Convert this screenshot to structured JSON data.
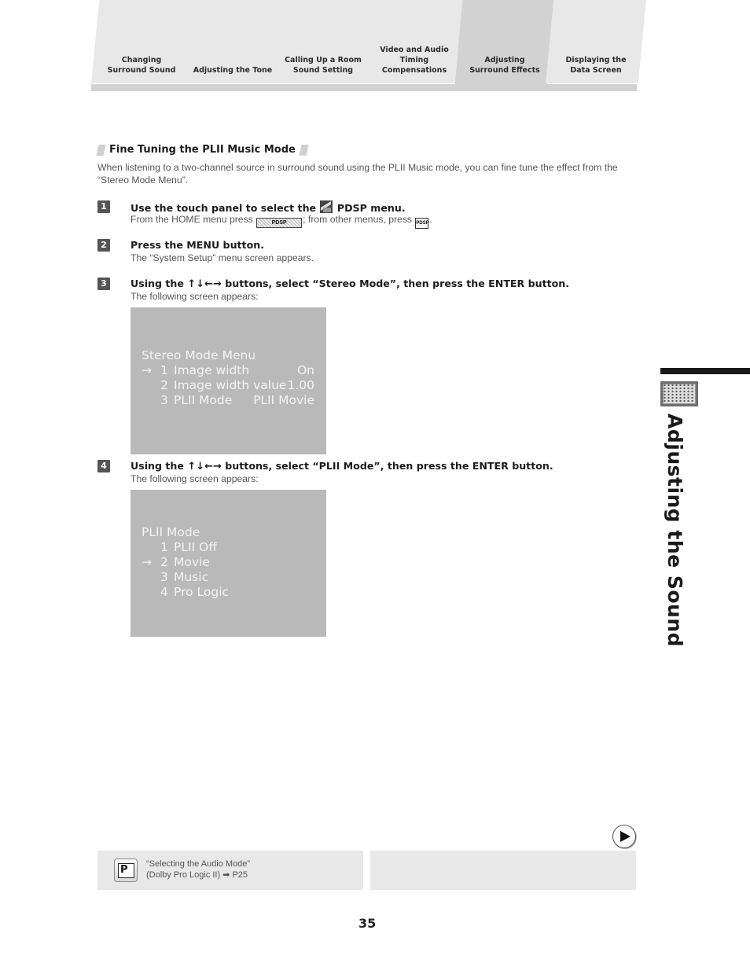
{
  "tabs": [
    {
      "label": "Changing\nSurround Sound",
      "active": false
    },
    {
      "label": "Adjusting the Tone",
      "active": false
    },
    {
      "label": "Calling Up a Room\nSound Setting",
      "active": false
    },
    {
      "label": "Video and Audio\nTiming\nCompensations",
      "active": false
    },
    {
      "label": "Adjusting\nSurround Effects",
      "active": true
    },
    {
      "label": "Displaying the\nData Screen",
      "active": false
    }
  ],
  "section": {
    "title": "Fine Tuning the PLII Music Mode",
    "intro": "When listening to a two-channel source in surround sound using the PLII Music mode, you can fine tune the effect from the “Stereo Mode Menu”."
  },
  "steps": [
    {
      "number": "1",
      "title_before": "Use the touch panel to select the",
      "title_after": "PDSP menu.",
      "icon": "pdsp-menu-icon",
      "sub_before": "From the HOME menu press",
      "key_wide": "PDSP",
      "sub_middle": "; from other menus, press",
      "key_small": "PDSP",
      "sub_after": "."
    },
    {
      "number": "2",
      "title": "Press the MENU button.",
      "sub": "The “System Setup” menu screen appears."
    },
    {
      "number": "3",
      "title_before": "Using the",
      "arrows": "↑↓←→",
      "title_after": "buttons, select “Stereo Mode”, then press the ENTER button.",
      "sub": "The following screen appears:"
    },
    {
      "number": "4",
      "title_before": "Using the",
      "arrows": "↑↓←→",
      "title_after": "buttons, select “PLII Mode”, then press the ENTER button.",
      "sub": "The following screen appears:"
    }
  ],
  "screen1": {
    "title": "Stereo Mode Menu",
    "cursor": "→",
    "rows": [
      {
        "num": "1",
        "label": "Image width",
        "value": "On",
        "selected": true
      },
      {
        "num": "2",
        "label": "Image width value",
        "value": "1.00",
        "selected": false
      },
      {
        "num": "3",
        "label": "PLII Mode",
        "value": "PLII Movie",
        "selected": false
      }
    ]
  },
  "screen2": {
    "title": "PLII Mode",
    "cursor": "→",
    "rows": [
      {
        "num": "1",
        "label": "PLII Off",
        "selected": false
      },
      {
        "num": "2",
        "label": "Movie",
        "selected": true
      },
      {
        "num": "3",
        "label": "Music",
        "selected": false
      },
      {
        "num": "4",
        "label": "Pro Logic",
        "selected": false
      }
    ]
  },
  "side_index": {
    "title": "Adjusting the Sound",
    "icon": "speaker-grid-icon"
  },
  "reference": {
    "icon_letter": "P",
    "line1": "“Selecting the Audio Mode”",
    "line2": "(Dolby Pro Logic II) ➡ P25"
  },
  "page_number": "35"
}
